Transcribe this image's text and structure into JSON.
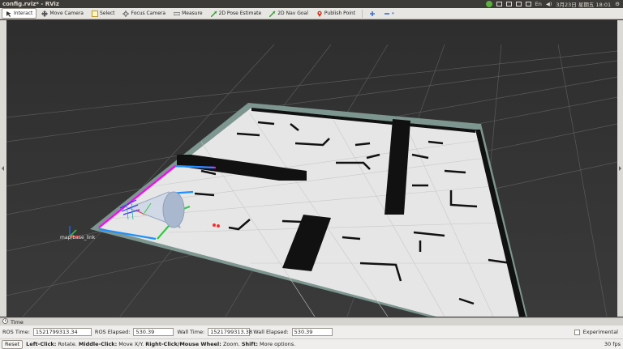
{
  "window": {
    "title": "config.rviz* - RViz"
  },
  "tray": {
    "ime": "En",
    "datetime": "3月23日 星期五 18:01"
  },
  "toolbar": {
    "tools": [
      {
        "label": "Interact",
        "icon": "interact-icon",
        "active": true
      },
      {
        "label": "Move Camera",
        "icon": "move-camera-icon"
      },
      {
        "label": "Select",
        "icon": "select-icon"
      },
      {
        "label": "Focus Camera",
        "icon": "focus-camera-icon"
      },
      {
        "label": "Measure",
        "icon": "measure-icon"
      },
      {
        "label": "2D Pose Estimate",
        "icon": "pose-arrow-icon"
      },
      {
        "label": "2D Nav Goal",
        "icon": "nav-goal-arrow-icon"
      },
      {
        "label": "Publish Point",
        "icon": "map-pin-icon"
      }
    ]
  },
  "viewport": {
    "frame_label": "map/base_link",
    "accent_green": "#2ecc40",
    "accent_magenta": "#ff00ff",
    "accent_blue": "#1e90ff"
  },
  "time_panel": {
    "header": "Time",
    "ros_time_label": "ROS Time:",
    "ros_time_value": "1521799313.34",
    "ros_elapsed_label": "ROS Elapsed:",
    "ros_elapsed_value": "530.39",
    "wall_time_label": "Wall Time:",
    "wall_time_value": "1521799313.38",
    "wall_elapsed_label": "Wall Elapsed:",
    "wall_elapsed_value": "530.39",
    "experimental_label": "Experimental"
  },
  "status": {
    "reset_label": "Reset",
    "left_click_label": "Left-Click:",
    "left_click_text": "Rotate.",
    "middle_click_label": "Middle-Click:",
    "middle_click_text": "Move X/Y.",
    "right_click_label": "Right-Click/Mouse Wheel:",
    "right_click_text": "Zoom.",
    "shift_label": "Shift:",
    "shift_text": "More options.",
    "fps": "30 fps"
  }
}
